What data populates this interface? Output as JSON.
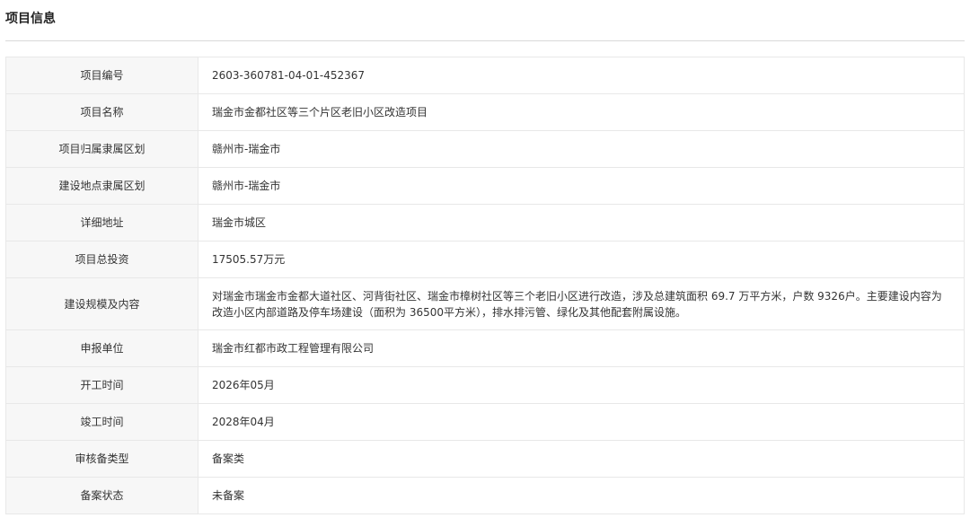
{
  "section": {
    "title": "项目信息"
  },
  "rows": [
    {
      "label": "项目编号",
      "value": "2603-360781-04-01-452367"
    },
    {
      "label": "项目名称",
      "value": "瑞金市金都社区等三个片区老旧小区改造项目"
    },
    {
      "label": "项目归属隶属区划",
      "value": "赣州市-瑞金市"
    },
    {
      "label": "建设地点隶属区划",
      "value": "赣州市-瑞金市"
    },
    {
      "label": "详细地址",
      "value": "瑞金市城区"
    },
    {
      "label": "项目总投资",
      "value": "17505.57万元"
    },
    {
      "label": "建设规模及内容",
      "value": "对瑞金市瑞金市金都大道社区、河背街社区、瑞金市樟树社区等三个老旧小区进行改造，涉及总建筑面积 69.7 万平方米，户数 9326户。主要建设内容为改造小区内部道路及停车场建设（面积为 36500平方米），排水排污管、绿化及其他配套附属设施。"
    },
    {
      "label": "申报单位",
      "value": "瑞金市红都市政工程管理有限公司"
    },
    {
      "label": "开工时间",
      "value": "2026年05月"
    },
    {
      "label": "竣工时间",
      "value": "2028年04月"
    },
    {
      "label": "审核备类型",
      "value": "备案类"
    },
    {
      "label": "备案状态",
      "value": "未备案"
    }
  ]
}
